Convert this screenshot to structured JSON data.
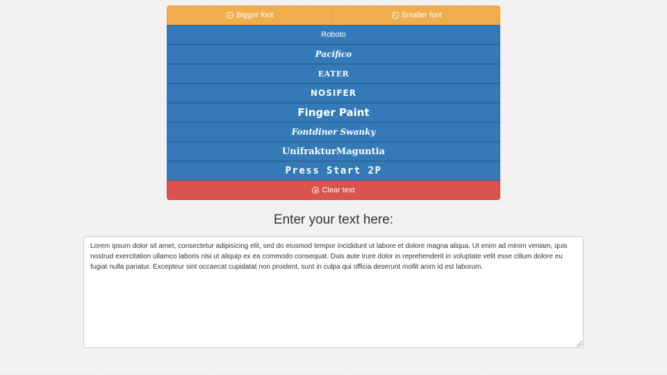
{
  "size_controls": {
    "bigger_label": "Bigger font",
    "smaller_label": "Smaller font"
  },
  "fonts": [
    "Roboto",
    "Pacifico",
    "EATER",
    "NOSIFER",
    "Finger Paint",
    "Fontdiner Swanky",
    "UnifrakturMaguntia",
    "Press Start 2P"
  ],
  "clear_label": "Clear text",
  "heading": "Enter your text here:",
  "editor": {
    "value": "Lorem ipsum dolor sit amet, consectetur adipisicing elit, sed do eiusmod tempor incididunt ut labore et dolore magna aliqua. Ut enim ad minim veniam, quis nostrud exercitation ullamco laboris nisi ut aliquip ex ea commodo consequat. Duis aute irure dolor in reprehenderit in voluptate velit esse cillum dolore eu fugiat nulla pariatur. Excepteur sint occaecat cupidatat non proident, sunt in culpa qui officia deserunt mollit anim id est laborum."
  },
  "colors": {
    "warning": "#f0ad4e",
    "primary": "#337ab7",
    "danger": "#d9534f"
  },
  "icons": {
    "bigger": "circle-arrow-up-icon",
    "smaller": "circle-arrow-down-icon",
    "clear": "remove-circle-icon"
  }
}
